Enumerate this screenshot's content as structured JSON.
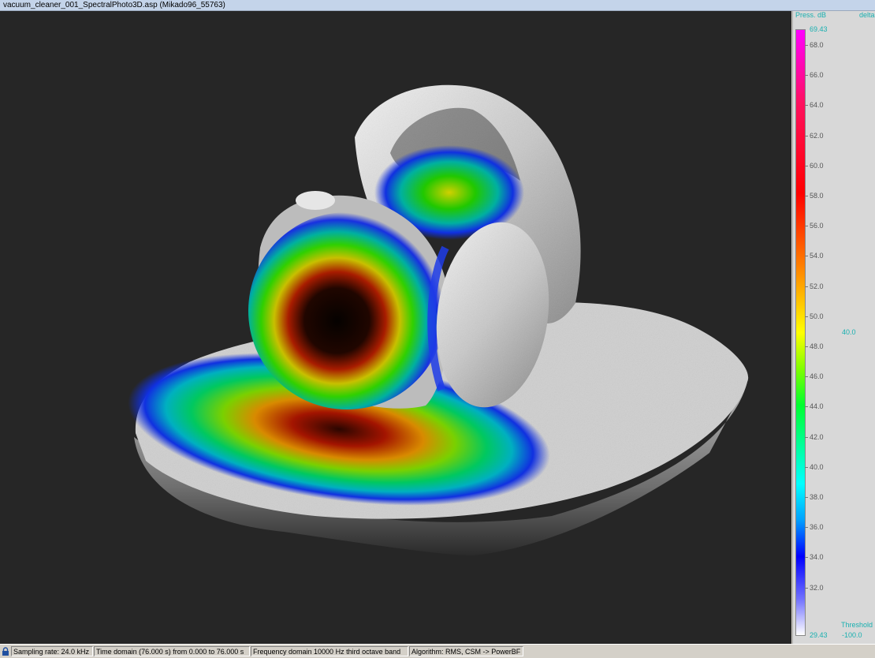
{
  "window": {
    "title": "vacuum_cleaner_001_SpectralPhoto3D.asp (Mikado96_55763)"
  },
  "legend": {
    "title": "Press. dB",
    "delta_label": "delta",
    "max_value": "69.43",
    "min_value": "29.43",
    "ticks": [
      "68.0",
      "66.0",
      "64.0",
      "62.0",
      "60.0",
      "58.0",
      "56.0",
      "54.0",
      "52.0",
      "50.0",
      "48.0",
      "46.0",
      "44.0",
      "42.0",
      "40.0",
      "38.0",
      "36.0",
      "34.0",
      "32.0"
    ],
    "delta_value": "40.0",
    "threshold_label": "Threshold",
    "threshold_value": "-100.0",
    "colormap": [
      "#ff00ff",
      "#ff0000",
      "#ff8000",
      "#ffff00",
      "#00ff30",
      "#00ffff",
      "#0000ff",
      "#ffffff"
    ]
  },
  "statusbar": {
    "lock_icon": "lock-icon",
    "sampling_rate": "Sampling rate: 24.0 kHz",
    "time_domain": "Time domain (76.000 s) from 0.000 to 76.000 s",
    "frequency_domain": "Frequency domain 10000 Hz third octave band",
    "algorithm": "Algorithm: RMS, CSM -> PowerBF"
  },
  "viewport": {
    "background": "#262626",
    "surface_color": "#cfcfcf"
  }
}
